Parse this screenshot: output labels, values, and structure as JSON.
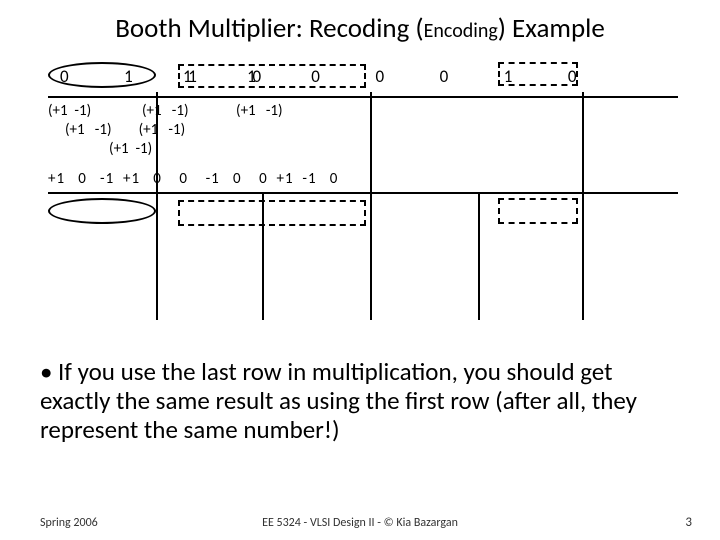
{
  "title_main": "Booth Multiplier: Recoding (",
  "title_sub": "Encoding",
  "title_end": ") Example",
  "bits_group1": "0   1   1   0",
  "bits_group2": "1   1   0   0   0   1   0",
  "recoding_lines": "(+1  -1)               (+1   -1)              (+1   -1)\n     (+1   -1)        (+1   -1)\n                  (+1  -1)",
  "result_row": "+1   0   -1  +1   0    0    -1   0    0  +1  -1   0",
  "bullet_text": "If you use the last row in multiplication, you should get exactly the same result as using the first row (after all, they represent the same number!)",
  "footer_left": "Spring 2006",
  "footer_center": "EE 5324 - VLSI Design II - © Kia Bazargan",
  "footer_right": "3"
}
